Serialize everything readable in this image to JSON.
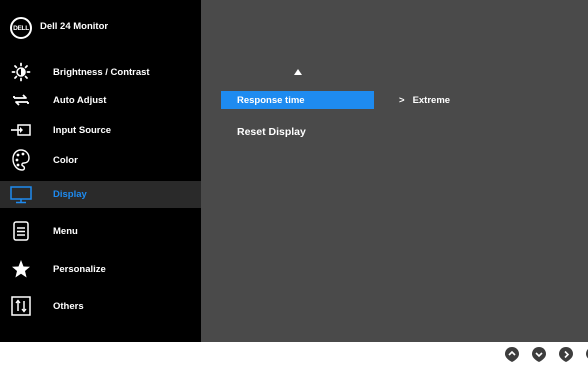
{
  "header": {
    "logo_text": "DELL",
    "model": "Dell 24 Monitor"
  },
  "sidebar": {
    "items": [
      {
        "label": "Brightness / Contrast",
        "icon": "brightness-icon"
      },
      {
        "label": "Auto Adjust",
        "icon": "auto-adjust-icon"
      },
      {
        "label": "Input Source",
        "icon": "input-source-icon"
      },
      {
        "label": "Color",
        "icon": "color-palette-icon"
      },
      {
        "label": "Display",
        "icon": "display-monitor-icon",
        "selected": true
      },
      {
        "label": "Menu",
        "icon": "menu-icon"
      },
      {
        "label": "Personalize",
        "icon": "star-icon"
      },
      {
        "label": "Others",
        "icon": "others-icon"
      }
    ]
  },
  "main": {
    "rows": [
      {
        "label": "Response time",
        "value": "Extreme",
        "selected": true
      },
      {
        "label": "Reset Display"
      }
    ],
    "value_prefix": ">"
  },
  "buttons": [
    "up-button",
    "down-button",
    "right-button",
    "exit-button"
  ],
  "colors": {
    "sidebar_bg": "#000000",
    "main_bg": "#4a4a4a",
    "accent": "#1e8bf0"
  }
}
